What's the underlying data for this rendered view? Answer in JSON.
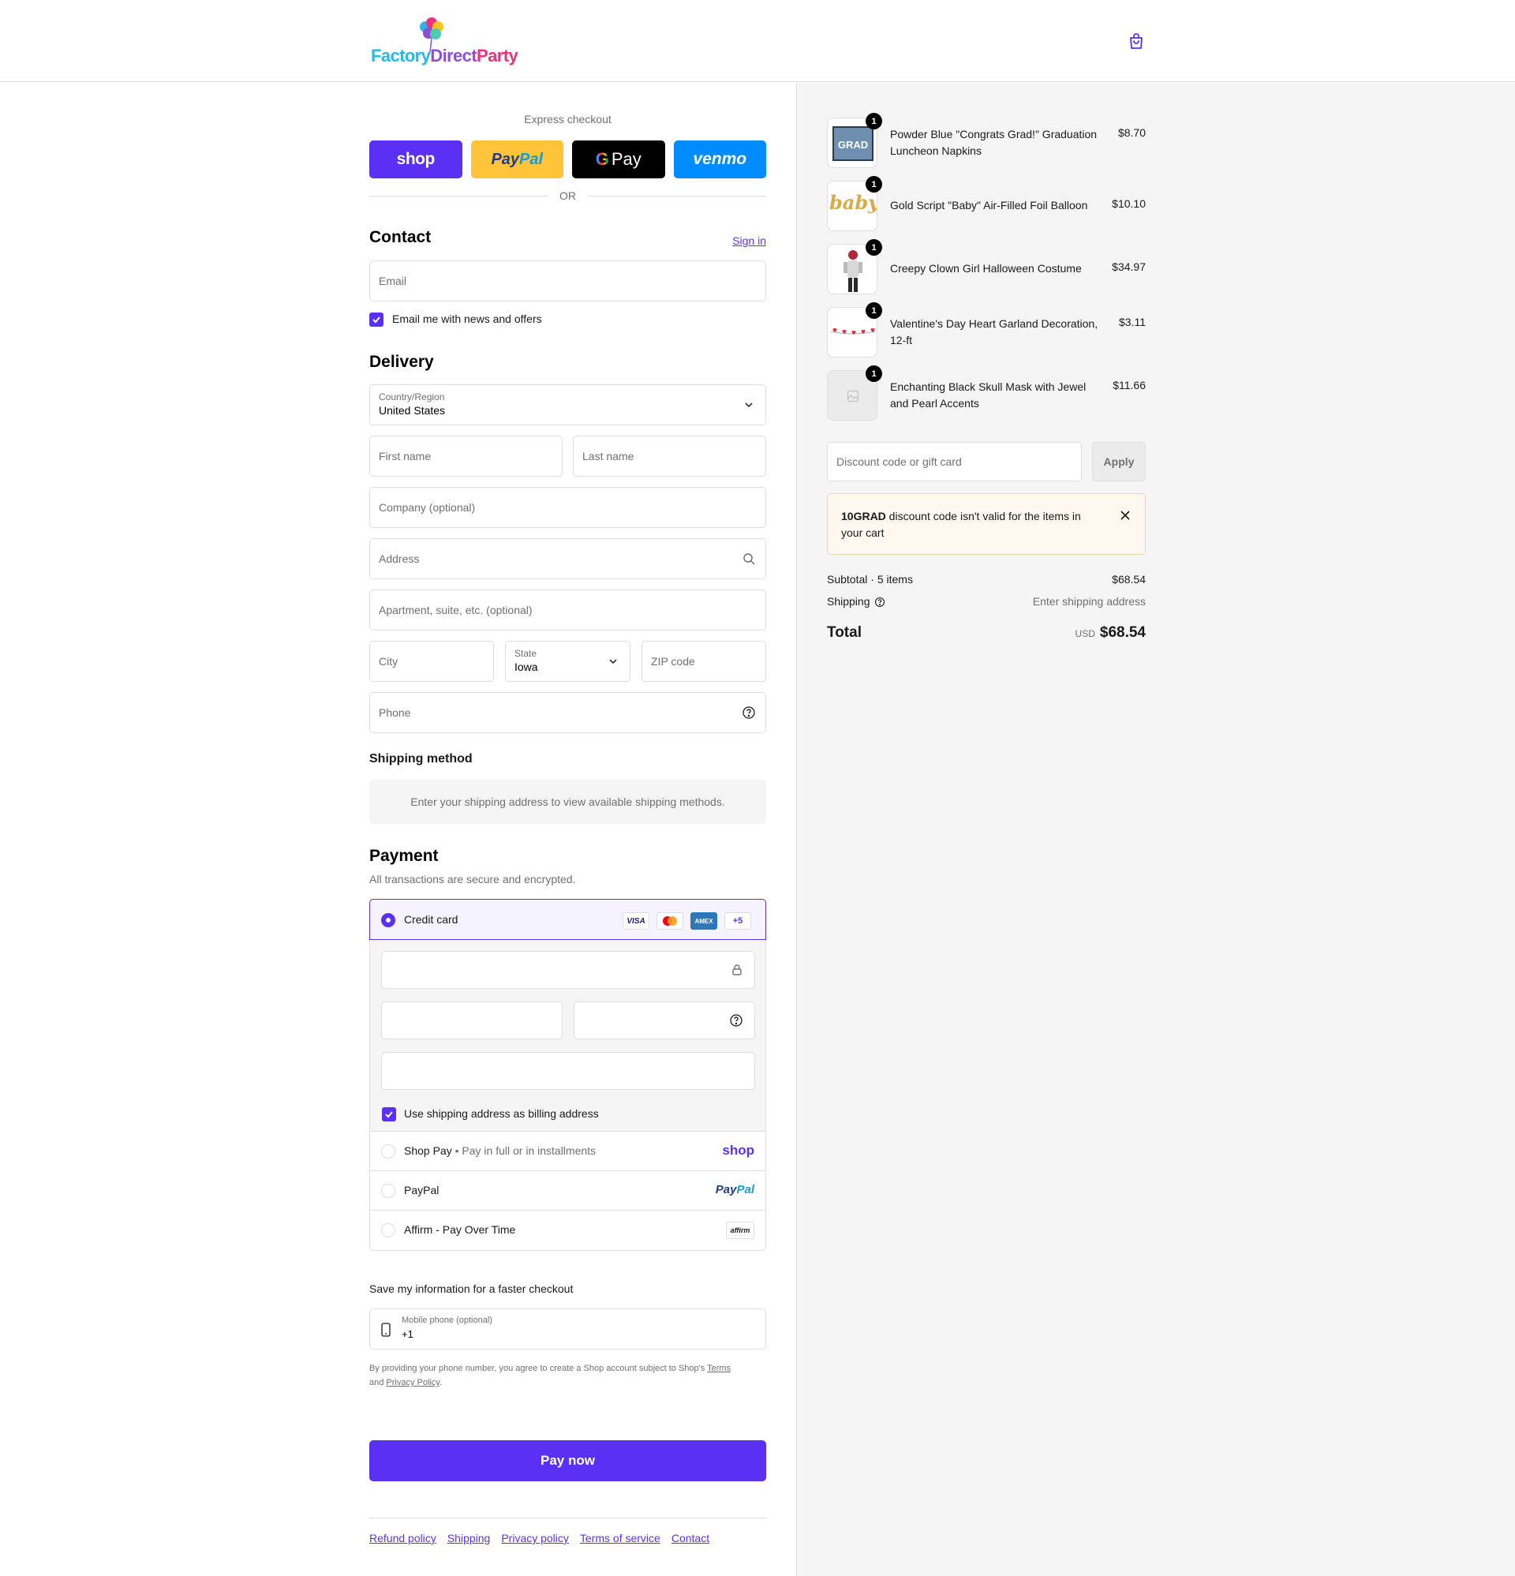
{
  "brand": {
    "logo_text": "FactoryDirectParty",
    "logo_parts": [
      "Factory",
      "Direct",
      "Party"
    ],
    "colors": {
      "accent": "#5a31f4",
      "logo_blue": "#29b6e8",
      "logo_purple": "#8e4fd6",
      "logo_pink": "#e8347c"
    }
  },
  "header": {
    "cart_icon": "shopping-bag-icon"
  },
  "express": {
    "title": "Express checkout",
    "buttons": {
      "shop": "shop",
      "paypal_a": "Pay",
      "paypal_b": "Pal",
      "gpay_g": "G",
      "gpay_pay": "Pay",
      "venmo": "venmo"
    },
    "or": "OR"
  },
  "contact": {
    "heading": "Contact",
    "sign_in": "Sign in",
    "email_placeholder": "Email",
    "news_label": "Email me with news and offers",
    "news_checked": true
  },
  "delivery": {
    "heading": "Delivery",
    "country_label": "Country/Region",
    "country_value": "United States",
    "first_name": "First name",
    "last_name": "Last name",
    "company": "Company (optional)",
    "address": "Address",
    "apartment": "Apartment, suite, etc. (optional)",
    "city": "City",
    "state_label": "State",
    "state_value": "Iowa",
    "zip": "ZIP code",
    "phone": "Phone"
  },
  "shipping": {
    "heading": "Shipping method",
    "message": "Enter your shipping address to view available shipping methods."
  },
  "payment": {
    "heading": "Payment",
    "subtitle": "All transactions are secure and encrypted.",
    "credit_card": "Credit card",
    "card_badges": [
      "VISA",
      "",
      "AMEX",
      "+5"
    ],
    "billing_label": "Use shipping address as billing address",
    "billing_checked": true,
    "options": [
      {
        "name": "Shop Pay",
        "sub": "Pay in full or in installments",
        "logo": "shop"
      },
      {
        "name": "PayPal",
        "logo_a": "Pay",
        "logo_b": "Pal"
      },
      {
        "name": "Affirm - Pay Over Time",
        "logo": "affirm"
      }
    ]
  },
  "save_info": {
    "heading": "Save my information for a faster checkout",
    "mobile_label": "Mobile phone (optional)",
    "mobile_value": "+1",
    "legal_1": "By providing your phone number, you agree to create a Shop account subject to Shop's ",
    "terms": "Terms",
    "legal_2": "and ",
    "privacy": "Privacy Policy",
    "legal_3": "."
  },
  "pay_now": "Pay now",
  "footer_links": [
    "Refund policy",
    "Shipping",
    "Privacy policy",
    "Terms of service",
    "Contact"
  ],
  "summary": {
    "items": [
      {
        "name": "Powder Blue \"Congrats Grad!\" Graduation Luncheon Napkins",
        "price": "$8.70",
        "qty": "1",
        "thumb_text": "GRAD"
      },
      {
        "name": "Gold Script \"Baby\" Air-Filled Foil Balloon",
        "price": "$10.10",
        "qty": "1",
        "thumb_text": "baby"
      },
      {
        "name": "Creepy Clown Girl Halloween Costume",
        "price": "$34.97",
        "qty": "1"
      },
      {
        "name": "Valentine's Day Heart Garland Decoration, 12-ft",
        "price": "$3.11",
        "qty": "1"
      },
      {
        "name": "Enchanting Black Skull Mask with Jewel and Pearl Accents",
        "price": "$11.66",
        "qty": "1"
      }
    ],
    "discount_placeholder": "Discount code or gift card",
    "apply": "Apply",
    "alert_code": "10GRAD",
    "alert_text": " discount code isn't valid for the items in your cart",
    "subtotal_label": "Subtotal · 5 items",
    "subtotal_value": "$68.54",
    "shipping_label": "Shipping",
    "shipping_value": "Enter shipping address",
    "total_label": "Total",
    "currency": "USD",
    "total_value": "$68.54"
  }
}
